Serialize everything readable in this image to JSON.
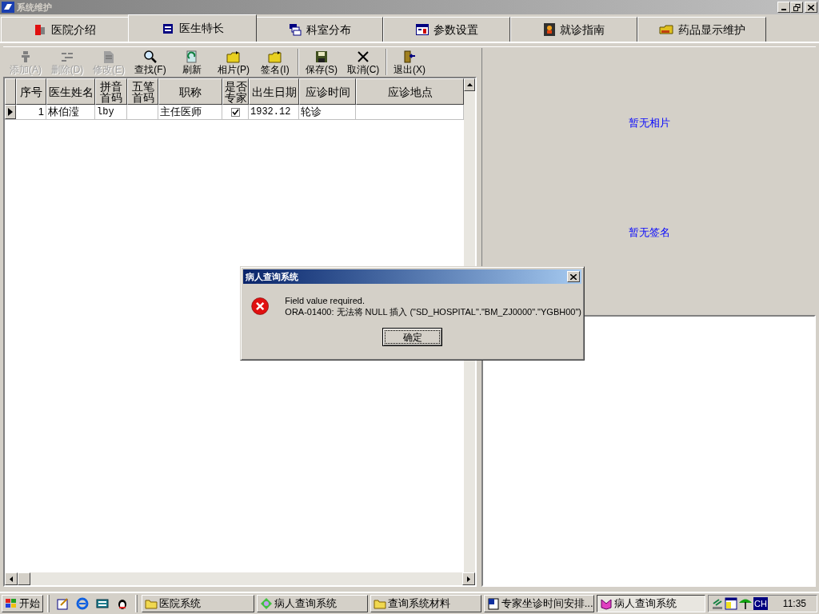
{
  "window": {
    "title": "系统维护"
  },
  "tabs": [
    {
      "label": "医院介绍",
      "selected": false
    },
    {
      "label": "医生特长",
      "selected": true
    },
    {
      "label": "科室分布",
      "selected": false
    },
    {
      "label": "参数设置",
      "selected": false
    },
    {
      "label": "就诊指南",
      "selected": false
    },
    {
      "label": "药品显示维护",
      "selected": false
    }
  ],
  "toolbar": {
    "groups": [
      [
        {
          "label": "添加(A)",
          "disabled": true
        },
        {
          "label": "删除(D)",
          "disabled": true
        },
        {
          "label": "修改(E)",
          "disabled": true
        },
        {
          "label": "查找(F)",
          "disabled": false
        },
        {
          "label": "刷新",
          "disabled": false
        },
        {
          "label": "相片(P)",
          "disabled": false
        },
        {
          "label": "签名(I)",
          "disabled": false
        }
      ],
      [
        {
          "label": "保存(S)",
          "disabled": false
        },
        {
          "label": "取消(C)",
          "disabled": false
        }
      ],
      [
        {
          "label": "退出(X)",
          "disabled": false
        }
      ]
    ]
  },
  "grid": {
    "columns": [
      "序号",
      "医生姓名",
      "拼音首码",
      "五笔首码",
      "职称",
      "是否专家",
      "出生日期",
      "应诊时间",
      "应诊地点"
    ],
    "rows": [
      {
        "selected": true,
        "cells": [
          {
            "kind": "number",
            "text": "1"
          },
          {
            "kind": "text",
            "text": "林伯滢"
          },
          {
            "kind": "mono",
            "text": "lby"
          },
          {
            "kind": "blank"
          },
          {
            "kind": "text",
            "text": "主任医师"
          },
          {
            "kind": "check",
            "checked": true
          },
          {
            "kind": "mono",
            "text": "1932.12"
          },
          {
            "kind": "text",
            "text": "轮诊"
          },
          {
            "kind": "blank"
          }
        ]
      }
    ]
  },
  "photo_panel": {
    "photo_text": "暂无相片",
    "signature_text": "暂无签名"
  },
  "dialog": {
    "title": "病人查询系统",
    "lines": [
      "Field value required.",
      "ORA-01400: 无法将 NULL 插入 (\"SD_HOSPITAL\".\"BM_ZJ0000\".\"YGBH00\")"
    ],
    "button": "确定"
  },
  "taskbar": {
    "start": "开始",
    "tasks": [
      {
        "label": "医院系统",
        "selected": false
      },
      {
        "label": "病人查询系统",
        "selected": false
      },
      {
        "label": "查询系统材料",
        "selected": false
      },
      {
        "label": "专家坐诊时间安排...",
        "selected": false
      },
      {
        "label": "病人查询系统",
        "selected": true
      }
    ],
    "tray_lang": "CH",
    "clock": "11:35"
  }
}
